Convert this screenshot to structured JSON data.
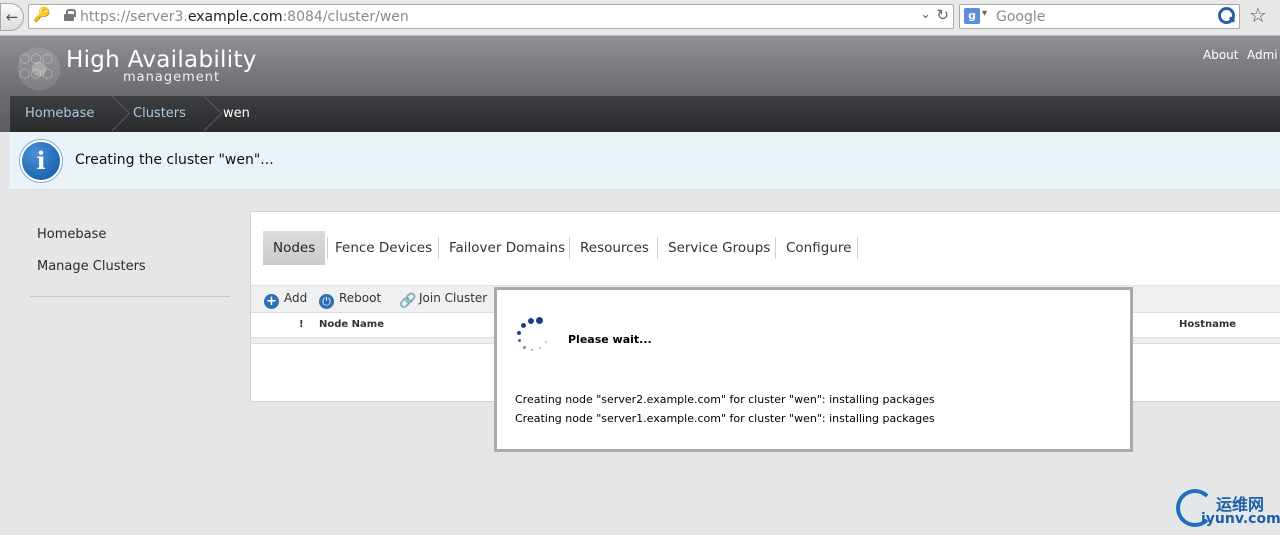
{
  "browser": {
    "url_prefix": "https://server3.",
    "url_domain": "example.com",
    "url_suffix": ":8084/cluster/wen",
    "search_placeholder": "Google"
  },
  "header": {
    "title": "High Availability",
    "subtitle": "management",
    "links": [
      "About",
      "Admi"
    ]
  },
  "breadcrumb": [
    "Homebase",
    "Clusters",
    "wen"
  ],
  "info_banner": {
    "text": "Creating the cluster \"wen\"..."
  },
  "sidebar": {
    "items": [
      "Homebase",
      "Manage Clusters"
    ]
  },
  "tabs": [
    "Nodes",
    "Fence Devices",
    "Failover Domains",
    "Resources",
    "Service Groups",
    "Configure"
  ],
  "active_tab": "Nodes",
  "toolbar": {
    "add": "Add",
    "reboot": "Reboot",
    "join": "Join Cluster"
  },
  "table": {
    "columns": [
      "!",
      "Node Name",
      "Hostname"
    ]
  },
  "modal": {
    "title": "Please wait...",
    "messages": [
      "Creating node \"server2.example.com\" for cluster \"wen\": installing packages",
      "Creating node \"server1.example.com\" for cluster \"wen\": installing packages"
    ]
  },
  "watermark": {
    "cn": "运维网",
    "en": "iyunv.com"
  },
  "colors": {
    "accent": "#2f6db5",
    "banner_bg": "#e9f3f8",
    "breadcrumb_link": "#a9c9e6"
  }
}
